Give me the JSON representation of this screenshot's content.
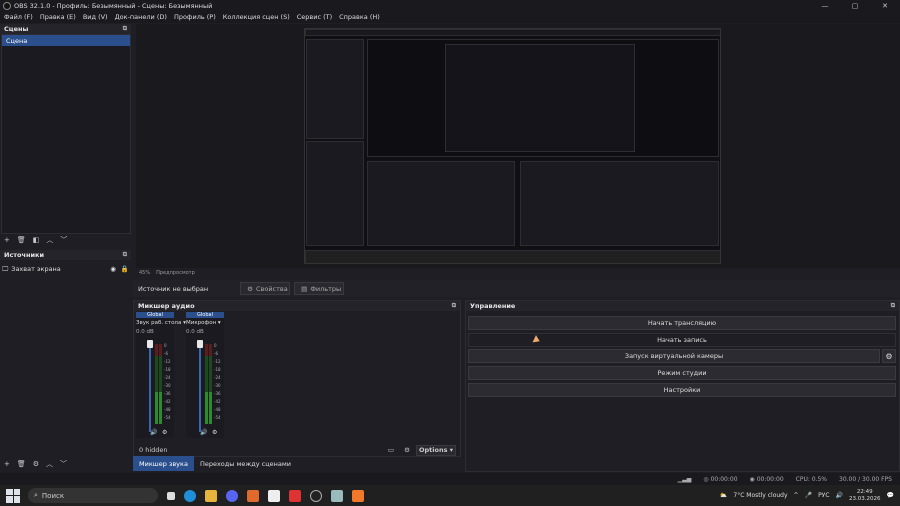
{
  "window": {
    "title": "OBS 32.1.0 - Профиль: Безымянный - Сцены: Безымянный"
  },
  "menu": [
    "Файл (F)",
    "Правка (E)",
    "Вид (V)",
    "Док-панели (D)",
    "Профиль (P)",
    "Коллекция сцен (S)",
    "Сервис (T)",
    "Справка (H)"
  ],
  "scenes": {
    "title": "Сцены",
    "items": [
      "Сцена"
    ]
  },
  "sources": {
    "title": "Источники",
    "items": [
      "Захват экрана"
    ]
  },
  "preview_status": {
    "zoom": "45%",
    "scale_label": "Предпросмотр"
  },
  "source_toolbar": {
    "no_source": "Источник не выбран",
    "properties": "Свойства",
    "filters": "Фильтры"
  },
  "mixer": {
    "title": "Микшер аудио",
    "channels": [
      {
        "tag": "Global",
        "name": "Звук раб. стола",
        "db": "0.0 dB"
      },
      {
        "tag": "Global",
        "name": "Микрофон",
        "db": "0.0 dB"
      }
    ],
    "scale": [
      "0",
      "-6",
      "-12",
      "-18",
      "-24",
      "-30",
      "-36",
      "-42",
      "-48",
      "-54",
      "-60"
    ],
    "hidden": "0 hidden",
    "options": "Options"
  },
  "tabs": [
    "Микшер звука",
    "Переходы между сценами"
  ],
  "controls": {
    "title": "Управление",
    "buttons": [
      "Начать трансляцию",
      "Начать запись",
      "Запуск виртуальной камеры",
      "Режим студии",
      "Настройки"
    ]
  },
  "statusbar": {
    "rec_time": "00:00:00",
    "stream_time": "00:00:00",
    "cpu": "CPU: 0.5%",
    "fps": "30.00 / 30.00 FPS"
  },
  "taskbar": {
    "search": "Поиск",
    "weather": "7°C  Mostly cloudy",
    "lang": "РУС",
    "time": "22:49",
    "date": "23.03.2026"
  },
  "colors": {
    "accent": "#2a4f8c",
    "meter_green": "#2d8a2d",
    "cursor": "#f2a96d"
  }
}
